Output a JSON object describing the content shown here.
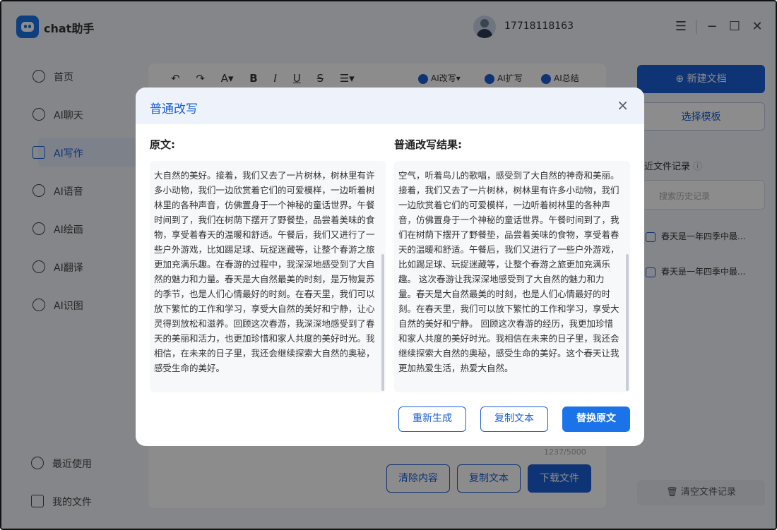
{
  "app": {
    "name": "chat助手"
  },
  "user": {
    "phone": "17718118163"
  },
  "window_controls": [
    "menu-icon",
    "minimize-icon",
    "maximize-icon",
    "close-icon"
  ],
  "sidebar": {
    "items": [
      {
        "label": "首页",
        "icon": "home-icon"
      },
      {
        "label": "AI聊天",
        "icon": "chat-icon"
      },
      {
        "label": "AI写作",
        "icon": "pen-icon",
        "active": true
      },
      {
        "label": "AI语音",
        "icon": "audio-icon"
      },
      {
        "label": "AI绘画",
        "icon": "palette-icon"
      },
      {
        "label": "AI翻译",
        "icon": "translate-icon"
      },
      {
        "label": "AI识图",
        "icon": "scan-icon"
      }
    ],
    "bottom": [
      {
        "label": "最近使用",
        "icon": "history-icon"
      },
      {
        "label": "我的文件",
        "icon": "file-icon"
      }
    ]
  },
  "editor": {
    "toolbar": [
      "↶",
      "↷",
      "A▾",
      "B",
      "I",
      "U",
      "S",
      "☰▾"
    ],
    "ai_tools": [
      "AI改写▾",
      "AI扩写",
      "AI总结"
    ],
    "counter": "1237/5000",
    "buttons": {
      "clear": "清除内容",
      "copy": "复制文本",
      "download": "下载文件"
    }
  },
  "right_panel": {
    "new_doc": "⊕ 新建文档",
    "template": "选择模板",
    "recent_title": "近文件记录",
    "search_placeholder": "搜索历史记录",
    "recent_items": [
      "春天是一年四季中最...",
      "春天是一年四季中最..."
    ],
    "clear": "清空文件记录"
  },
  "modal": {
    "title": "普通改写",
    "left_label": "原文:",
    "right_label": "普通改写结果:",
    "original_text": "大自然的美好。接着，我们又去了一片树林，树林里有许多小动物，我们一边欣赏着它们的可爱模样，一边听着树林里的各种声音，仿佛置身于一个神秘的童话世界。午餐时间到了，我们在树荫下摆开了野餐垫，品尝着美味的食物，享受着春天的温暖和舒适。午餐后，我们又进行了一些户外游戏，比如踢足球、玩捉迷藏等，让整个春游之旅更加充满乐趣。在春游的过程中，我深深地感受到了大自然的魅力和力量。春天是大自然最美的时刻，是万物复苏的季节，也是人们心情最好的时刻。在春天里，我们可以放下繁忙的工作和学习，享受大自然的美好和宁静，让心灵得到放松和滋养。回顾这次春游，我深深地感受到了春天的美丽和活力，也更加珍惜和家人共度的美好时光。我相信，在未来的日子里，我还会继续探索大自然的奥秘，感受生命的美好。",
    "rewritten_text": "空气，听着鸟儿的歌唱，感受到了大自然的神奇和美丽。 接着，我们又去了一片树林，树林里有许多小动物，我们一边欣赏着它们的可爱模样，一边听着树林里的各种声音，仿佛置身于一个神秘的童话世界。午餐时间到了，我们在树荫下摆开了野餐垫，品尝着美味的食物，享受着春天的温暖和舒适。午餐后，我们又进行了一些户外游戏，比如踢足球、玩捉迷藏等，让整个春游之旅更加充满乐趣。 这次春游让我深深地感受到了大自然的魅力和力量。春天是大自然最美的时刻，也是人们心情最好的时刻。在春天里，我们可以放下繁忙的工作和学习，享受大自然的美好和宁静。 回顾这次春游的经历，我更加珍惜和家人共度的美好时光。我相信在未来的日子里，我还会继续探索大自然的奥秘，感受生命的美好。这个春天让我更加热爱生活，热爱大自然。",
    "buttons": {
      "regenerate": "重新生成",
      "copy": "复制文本",
      "replace": "替换原文"
    },
    "close_icon": "×"
  },
  "colors": {
    "accent": "#1a5fd6",
    "primary_button": "#1a73e8",
    "overlay": "rgba(0,0,0,0.45)"
  }
}
